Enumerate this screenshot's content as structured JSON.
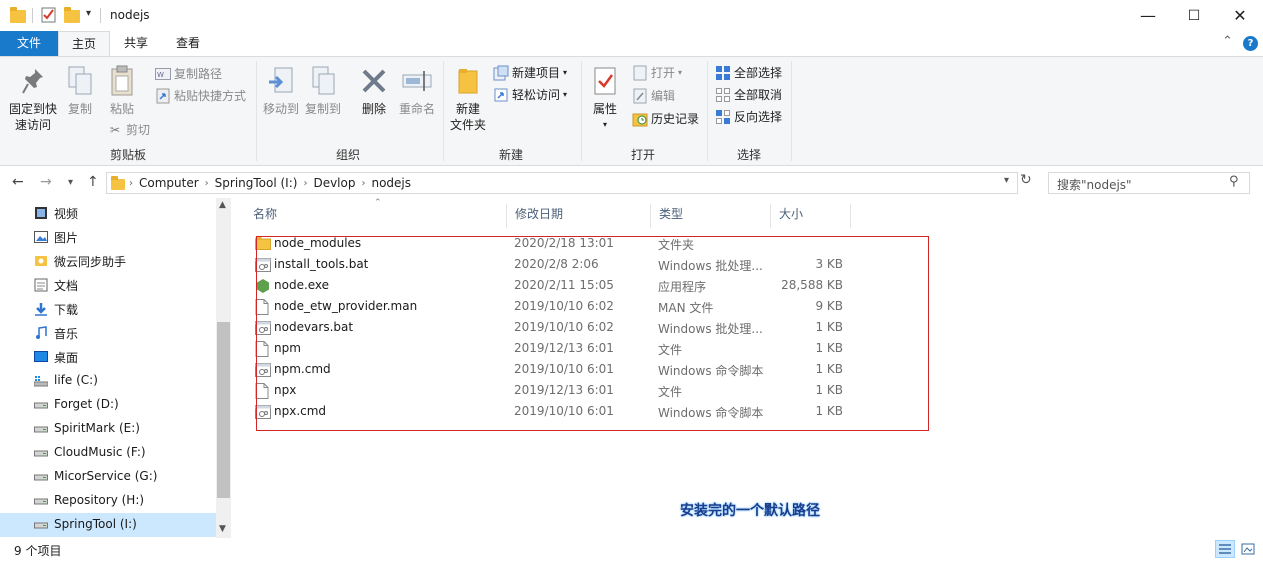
{
  "window": {
    "title": "nodejs",
    "minimize": "—",
    "maximize": "☐",
    "close": "✕",
    "expand_ribbon": "⌃",
    "help": "?"
  },
  "ribbon_tabs": [
    "文件",
    "主页",
    "共享",
    "查看"
  ],
  "ribbon": {
    "clipboard": {
      "label": "剪贴板",
      "pin_label_1": "固定到快",
      "pin_label_2": "速访问",
      "copy": "复制",
      "paste": "粘贴",
      "copy_path": "复制路径",
      "paste_shortcut": "粘贴快捷方式",
      "cut": "剪切"
    },
    "organize": {
      "label": "组织",
      "move_to": "移动到",
      "copy_to": "复制到",
      "delete": "删除",
      "rename": "重命名"
    },
    "new": {
      "label": "新建",
      "new_folder_1": "新建",
      "new_folder_2": "文件夹",
      "new_item": "新建项目",
      "easy_access": "轻松访问"
    },
    "open": {
      "label": "打开",
      "properties": "属性",
      "open": "打开",
      "edit": "编辑",
      "history": "历史记录"
    },
    "select": {
      "label": "选择",
      "select_all": "全部选择",
      "select_none": "全部取消",
      "invert": "反向选择"
    }
  },
  "address": {
    "breadcrumbs": [
      "Computer",
      "SpringTool (I:)",
      "Devlop",
      "nodejs"
    ],
    "search_placeholder": "搜索\"nodejs\""
  },
  "nav_pane": [
    {
      "label": "视频",
      "icon": "video-icon"
    },
    {
      "label": "图片",
      "icon": "picture-icon"
    },
    {
      "label": "微云同步助手",
      "icon": "weiyun-icon"
    },
    {
      "label": "文档",
      "icon": "document-icon"
    },
    {
      "label": "下载",
      "icon": "download-icon"
    },
    {
      "label": "音乐",
      "icon": "music-icon"
    },
    {
      "label": "桌面",
      "icon": "desktop-icon"
    },
    {
      "label": "life (C:)",
      "icon": "system-drive-icon"
    },
    {
      "label": "Forget (D:)",
      "icon": "drive-icon"
    },
    {
      "label": "SpiritMark (E:)",
      "icon": "drive-icon"
    },
    {
      "label": "CloudMusic (F:)",
      "icon": "drive-icon"
    },
    {
      "label": "MicorService (G:)",
      "icon": "drive-icon"
    },
    {
      "label": "Repository (H:)",
      "icon": "drive-icon"
    },
    {
      "label": "SpringTool (I:)",
      "icon": "drive-icon",
      "selected": true
    }
  ],
  "columns": {
    "name": "名称",
    "date": "修改日期",
    "type": "类型",
    "size": "大小"
  },
  "files": [
    {
      "name": "node_modules",
      "date": "2020/2/18 13:01",
      "type": "文件夹",
      "size": "",
      "icon": "folder-icon"
    },
    {
      "name": "install_tools.bat",
      "date": "2020/2/8 2:06",
      "type": "Windows 批处理...",
      "size": "3 KB",
      "icon": "batch-file-icon"
    },
    {
      "name": "node.exe",
      "date": "2020/2/11 15:05",
      "type": "应用程序",
      "size": "28,588 KB",
      "icon": "node-exe-icon"
    },
    {
      "name": "node_etw_provider.man",
      "date": "2019/10/10 6:02",
      "type": "MAN 文件",
      "size": "9 KB",
      "icon": "file-icon"
    },
    {
      "name": "nodevars.bat",
      "date": "2019/10/10 6:02",
      "type": "Windows 批处理...",
      "size": "1 KB",
      "icon": "batch-file-icon"
    },
    {
      "name": "npm",
      "date": "2019/12/13 6:01",
      "type": "文件",
      "size": "1 KB",
      "icon": "file-icon"
    },
    {
      "name": "npm.cmd",
      "date": "2019/10/10 6:01",
      "type": "Windows 命令脚本",
      "size": "1 KB",
      "icon": "batch-file-icon"
    },
    {
      "name": "npx",
      "date": "2019/12/13 6:01",
      "type": "文件",
      "size": "1 KB",
      "icon": "file-icon"
    },
    {
      "name": "npx.cmd",
      "date": "2019/10/10 6:01",
      "type": "Windows 命令脚本",
      "size": "1 KB",
      "icon": "batch-file-icon"
    }
  ],
  "annotation": "安装完的一个默认路径",
  "status": {
    "item_count": "9 个项目"
  },
  "colors": {
    "accent": "#1979ca",
    "highlight_box": "#d32626",
    "selected_nav": "#cce8ff"
  }
}
